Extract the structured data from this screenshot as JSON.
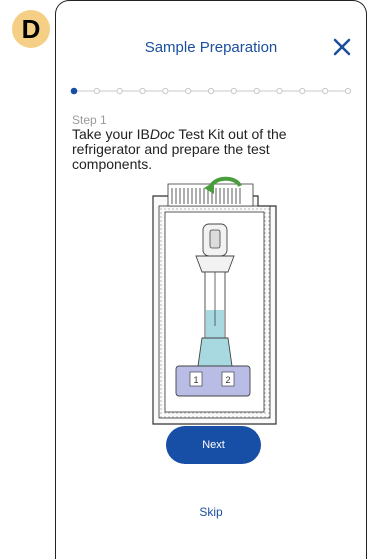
{
  "badge": {
    "label": "D"
  },
  "header": {
    "title": "Sample Preparation",
    "close_icon": "close-icon"
  },
  "progress": {
    "total_steps": 13,
    "current_step": 1
  },
  "step": {
    "label": "Step 1",
    "text_before": "Take your IB",
    "text_italic": "Doc",
    "text_after": " Test Kit out of the refrigerator and prepare the test components."
  },
  "illustration": {
    "icon": "test-kit-illustration",
    "cassette_labels": [
      "1",
      "2"
    ]
  },
  "actions": {
    "next_label": "Next",
    "skip_label": "Skip"
  },
  "colors": {
    "accent": "#174ea6",
    "title": "#1b4f9c",
    "badge": "#f6cf86",
    "liquid": "#a8d8e0",
    "cap": "#b9bde6"
  }
}
